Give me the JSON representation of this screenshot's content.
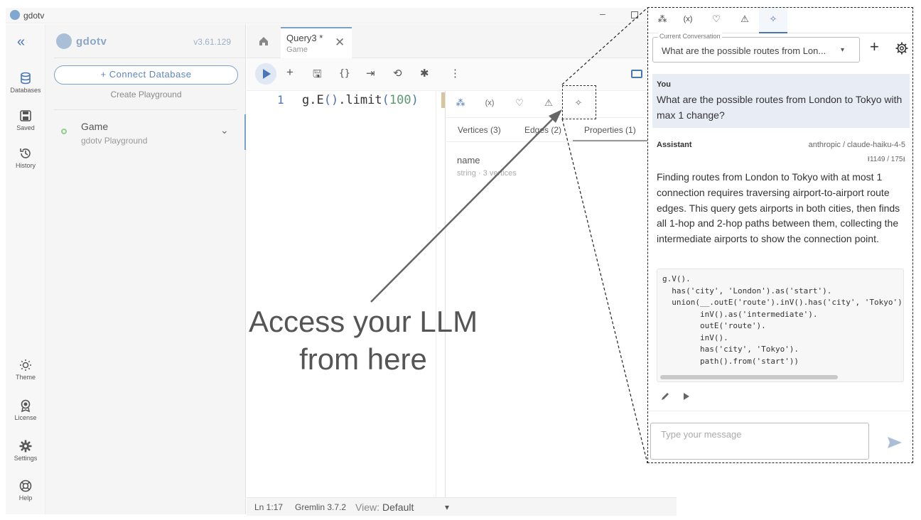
{
  "window": {
    "title": "gdotv",
    "min": "–"
  },
  "rail": {
    "collapse": "«",
    "top_items": [
      {
        "label": "Databases",
        "icon": "database-icon"
      },
      {
        "label": "Saved",
        "icon": "save-icon"
      },
      {
        "label": "History",
        "icon": "history-icon"
      }
    ],
    "bottom_items": [
      {
        "label": "Theme",
        "icon": "sun-icon"
      },
      {
        "label": "License",
        "icon": "license-icon"
      },
      {
        "label": "Settings",
        "icon": "gear-icon"
      },
      {
        "label": "Help",
        "icon": "lifebuoy-icon"
      }
    ]
  },
  "connections": {
    "brand": "gdotv",
    "version": "v3.61.129",
    "connect_label": "+ Connect Database",
    "create_playground": "Create Playground",
    "item": {
      "name": "Game",
      "subtitle": "gdotv Playground",
      "chevron": "⌄"
    }
  },
  "tabs": {
    "query_tab": {
      "title": "Query3 *",
      "subtitle": "Game",
      "close": "✕"
    }
  },
  "toolbar": {
    "add": "+",
    "save": "🖫",
    "format": "{}",
    "diff": "⇥",
    "history": "⟲",
    "debug": "✱",
    "more": "⋮"
  },
  "editor": {
    "line_number": "1",
    "code": {
      "a": "g.E",
      "b": "()",
      "c": ".limit",
      "d": "(",
      "e": "100",
      "f": ")"
    }
  },
  "results": {
    "icon_tabs": [
      "⁂",
      "(x)",
      "♡",
      "⚠",
      "✧"
    ],
    "sub_tabs": [
      "Vertices (3)",
      "Edges (2)",
      "Properties (1)"
    ],
    "property": {
      "name": "name",
      "type": "string · 3 vertices"
    }
  },
  "status": {
    "position": "Ln 1:17",
    "language": "Gremlin 3.7.2",
    "view_label": "View:",
    "view_value": "Default",
    "view_arrow": "▾"
  },
  "annotation": {
    "line1": "Access your LLM",
    "line2": "from here"
  },
  "chat": {
    "tabs": [
      "⁂",
      "(x)",
      "♡",
      "⚠",
      "✧"
    ],
    "conversation_label": "Current Conversation",
    "conversation_value": "What are the possible routes from Lon...",
    "conversation_arrow": "▾",
    "new_conversation": "+",
    "user_label": "You",
    "user_message": "What are the possible routes from London to Tokyo with max 1 change?",
    "assistant_label": "Assistant",
    "model": "anthropic / claude-haiku-4-5",
    "tokens": "⭱1149 / 175⭳",
    "assistant_message": "Finding routes from London to Tokyo with at most 1 connection requires traversing airport-to-airport route edges. This query gets airports in both cities, then finds all 1-hop and 2-hop paths between them, collecting the intermediate airports to show the connection point.",
    "code": "g.V().\n  has('city', 'London').as('start').\n  union(__.outE('route').inV().has('city', 'Tokyo'),\n        inV().as('intermediate').\n        outE('route').\n        inV().\n        has('city', 'Tokyo').\n        path().from('start'))",
    "input_placeholder": "Type your message"
  },
  "colors": {
    "accent": "#4a76b5",
    "highlight_bg": "#e8edf5"
  }
}
